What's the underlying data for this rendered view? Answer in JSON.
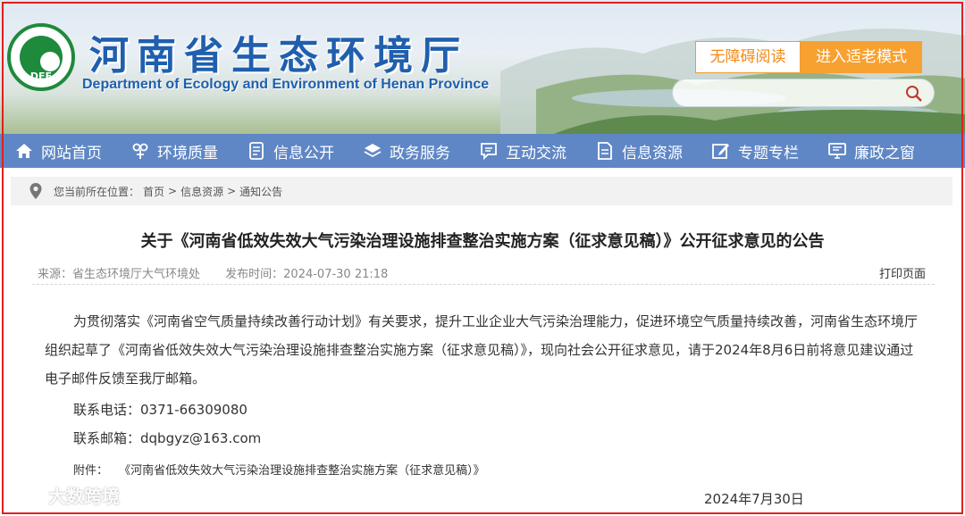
{
  "header": {
    "logo_text": "DEE",
    "title": "河南省生态环境厅",
    "subtitle": "Department of Ecology and Environment of Henan Province",
    "accessibility_label": "无障碍阅读",
    "elder_mode_label": "进入适老模式",
    "search_placeholder": ""
  },
  "nav": {
    "items": [
      {
        "label": "网站首页",
        "icon": "home-icon"
      },
      {
        "label": "环境质量",
        "icon": "leaf-icon"
      },
      {
        "label": "信息公开",
        "icon": "document-icon"
      },
      {
        "label": "政务服务",
        "icon": "layers-icon"
      },
      {
        "label": "互动交流",
        "icon": "chat-icon"
      },
      {
        "label": "信息资源",
        "icon": "file-icon"
      },
      {
        "label": "专题专栏",
        "icon": "edit-icon"
      },
      {
        "label": "廉政之窗",
        "icon": "monitor-icon"
      }
    ]
  },
  "breadcrumb": {
    "prefix": "您当前所在位置：",
    "items": [
      "首页",
      "信息资源",
      "通知公告"
    ],
    "separator": ">"
  },
  "article": {
    "title": "关于《河南省低效失效大气污染治理设施排查整治实施方案（征求意见稿）》公开征求意见的公告",
    "source": "来源：省生态环境厅大气环境处",
    "publish_time": "发布时间：2024-07-30 21:18",
    "print_label": "打印页面",
    "body": "为贯彻落实《河南省空气质量持续改善行动计划》有关要求，提升工业企业大气污染治理能力，促进环境空气质量持续改善，河南省生态环境厅组织起草了《河南省低效失效大气污染治理设施排查整治实施方案（征求意见稿）》，现向社会公开征求意见，请于2024年8月6日前将意见建议通过电子邮件反馈至我厅邮箱。",
    "phone": "联系电话：0371-66309080",
    "email": "联系邮箱：dqbgyz@163.com",
    "attachment_prefix": "附件：",
    "attachment": "《河南省低效失效大气污染治理设施排查整治实施方案（征求意见稿）》",
    "date": "2024年7月30日"
  },
  "watermark": "大数跨境",
  "colors": {
    "nav_bg": "#5f87c5",
    "title_blue": "#1f5fae",
    "elder_orange": "#f7a132",
    "logo_green": "#1e8a3c",
    "frame_red": "#e0201f"
  }
}
